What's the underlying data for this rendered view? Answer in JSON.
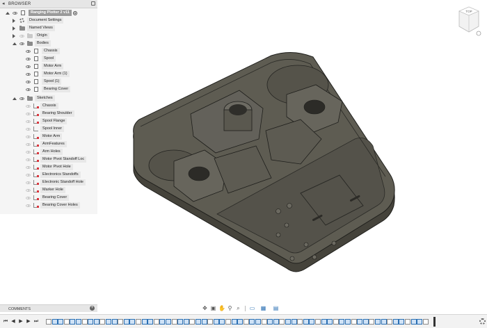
{
  "browser": {
    "title": "BROWSER",
    "root": "Ranging Plotter 2 v11",
    "items": [
      {
        "label": "Document Settings"
      },
      {
        "label": "Named Views"
      },
      {
        "label": "Origin"
      },
      {
        "label": "Bodies"
      }
    ],
    "bodies": [
      "Chassis",
      "Spool",
      "Motor Arm",
      "Motor Arm (1)",
      "Spool (1)",
      "Bearing Cover"
    ],
    "sketches_label": "Sketches",
    "sketches": [
      "Chassis",
      "Bearing Shoulder",
      "Spool Flange",
      "Spool Inner",
      "Motor Arm",
      "ArmFeatures",
      "Arm Holes",
      "Motor Pivot Standoff Loc",
      "Motor Pivot Hole",
      "Electronics Standoffs",
      "Electronic Standoff Hole",
      "Marker Hole",
      "Bearing Cover",
      "Bearing Cover Holes"
    ]
  },
  "comments": {
    "title": "COMMENTS"
  },
  "viewcube": {
    "face_label": "TOP"
  },
  "navbar": {
    "icons": [
      "orbit-icon",
      "look-at-icon",
      "pan-icon",
      "zoom-icon",
      "fit-icon",
      "display-settings-icon",
      "grid-icon",
      "viewports-icon"
    ]
  },
  "timeline": {
    "playback": [
      "first-frame-icon",
      "previous-frame-icon",
      "play-icon",
      "next-frame-icon",
      "last-frame-icon"
    ],
    "feature_count": 64
  },
  "colors": {
    "model_top": "#5e5c52",
    "model_side": "#45433b",
    "model_edge": "#1e1e1b",
    "accent_blue": "#2a6fb3",
    "sketch_red": "#d9363e"
  }
}
